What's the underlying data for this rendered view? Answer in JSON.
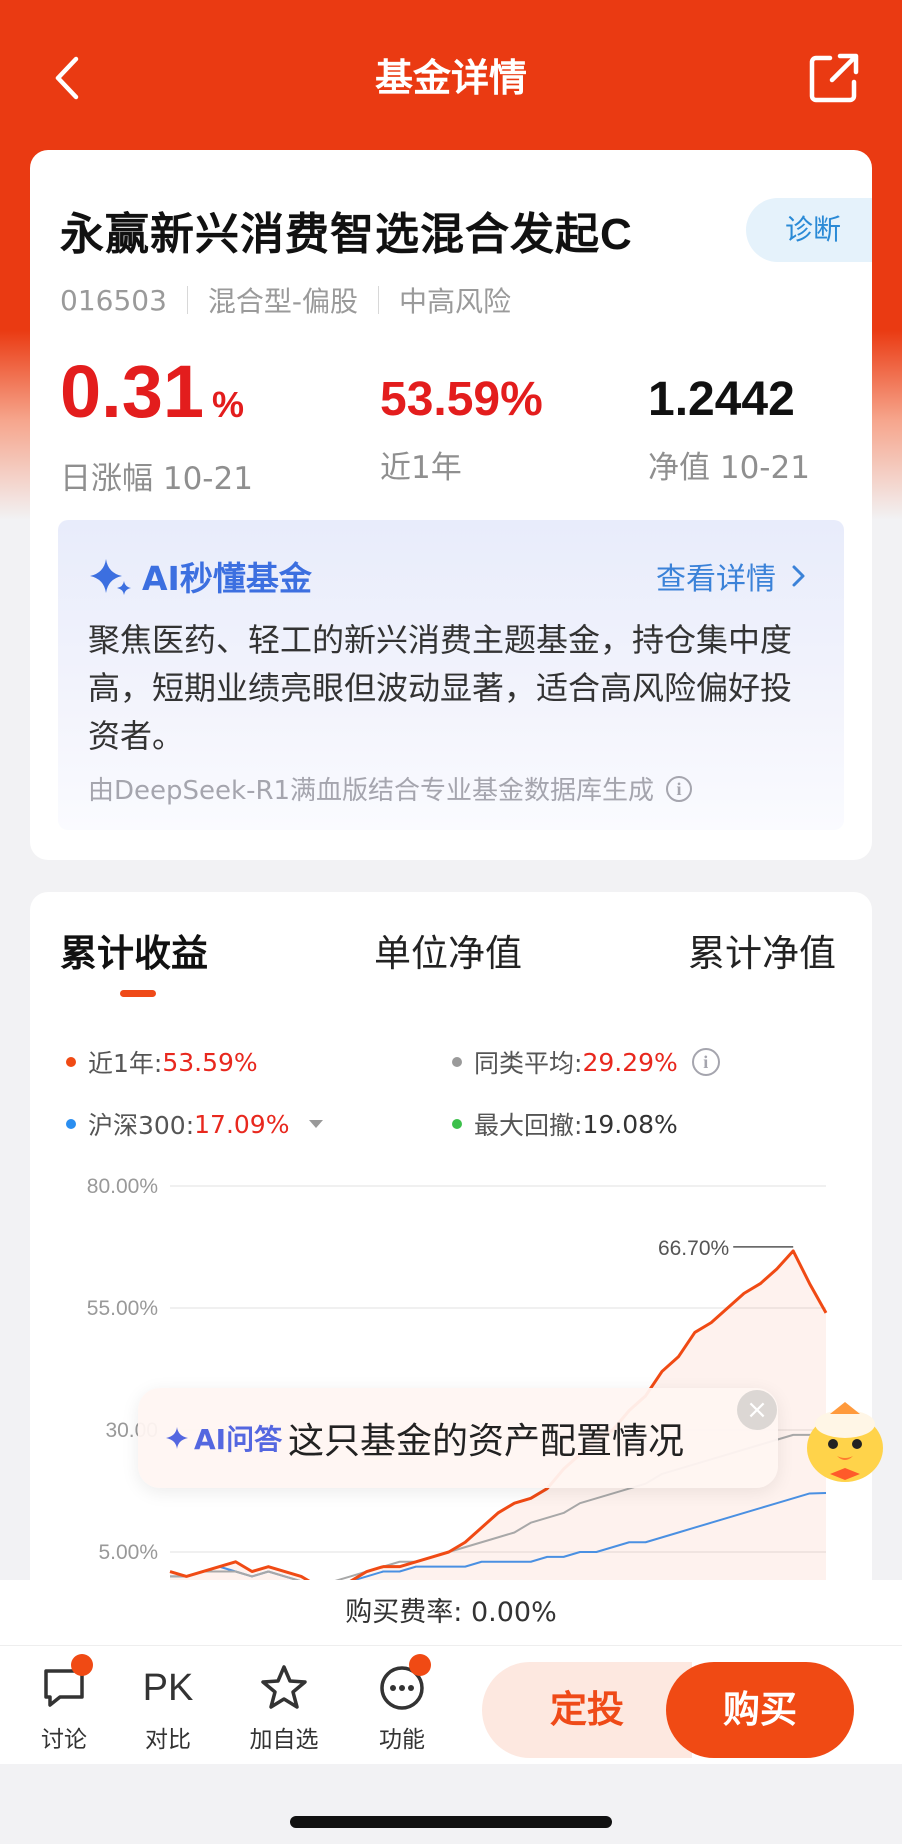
{
  "nav": {
    "title": "基金详情",
    "back_icon": "chevron-left-icon",
    "share_icon": "share-icon"
  },
  "fund": {
    "name": "永赢新兴消费智选混合发起C",
    "code": "016503",
    "type": "混合型-偏股",
    "risk": "中高风险",
    "diagnose_label": "诊断"
  },
  "stats": {
    "daily_change": "0.31",
    "daily_change_unit": "%",
    "daily_change_label": "日涨幅 10-21",
    "year_return": "53.59%",
    "year_return_label": "近1年",
    "nav_value": "1.2442",
    "nav_label": "净值 10-21"
  },
  "ai_summary": {
    "title": "AI秒懂基金",
    "more_label": "查看详情",
    "text": "聚焦医药、轻工的新兴消费主题基金，持仓集中度高，短期业绩亮眼但波动显著，适合高风险偏好投资者。",
    "footer": "由DeepSeek-R1满血版结合专业基金数据库生成"
  },
  "chart_tabs": [
    "累计收益",
    "单位净值",
    "累计净值"
  ],
  "legend": {
    "year": {
      "label": "近1年:",
      "value": "53.59%",
      "color": "#f04a14"
    },
    "peer": {
      "label": "同类平均:",
      "value": "29.29%",
      "color": "#9a9a9a"
    },
    "hs300": {
      "label": "沪深300:",
      "value": "17.09%",
      "color": "#2a8ef0"
    },
    "drawdown": {
      "label": "最大回撤:",
      "value": "19.08%",
      "color": "#3cc04b"
    }
  },
  "chart_data": {
    "type": "line",
    "y_ticks": [
      "80.00%",
      "55.00%",
      "30.00",
      "5.00%"
    ],
    "ylim": [
      -5,
      80
    ],
    "peak_label": "66.70%",
    "x": [
      0,
      1,
      2,
      3,
      4,
      5,
      6,
      7,
      8,
      9,
      10,
      11,
      12,
      13,
      14,
      15,
      16,
      17,
      18,
      19,
      20,
      21,
      22,
      23,
      24,
      25,
      26,
      27,
      28,
      29,
      30,
      31,
      32,
      33,
      34,
      35,
      36,
      37,
      38,
      39,
      40
    ],
    "series": [
      {
        "values": [
          1,
          0,
          1,
          2,
          3,
          1,
          2,
          1,
          0,
          -2,
          -3,
          -1,
          1,
          2,
          2,
          3,
          4,
          5,
          7,
          10,
          13,
          15,
          16,
          18,
          22,
          25,
          28,
          30,
          34,
          37,
          42,
          45,
          50,
          52,
          55,
          58,
          60,
          63,
          66.7,
          60,
          54
        ]
      },
      {
        "values": [
          0,
          0,
          1,
          1,
          1,
          0,
          1,
          0,
          -1,
          -2,
          -1,
          0,
          1,
          2,
          3,
          3,
          4,
          5,
          6,
          7,
          8,
          9,
          11,
          12,
          13,
          15,
          16,
          17,
          18,
          19,
          21,
          22,
          23,
          24,
          25,
          26,
          27,
          28,
          29,
          29,
          29.3
        ]
      },
      {
        "values": [
          0,
          0,
          1,
          2,
          1,
          0,
          1,
          0,
          -1,
          -2,
          -2,
          -1,
          0,
          1,
          1,
          2,
          2,
          2,
          2,
          3,
          3,
          3,
          3,
          4,
          4,
          5,
          5,
          6,
          7,
          7,
          8,
          9,
          10,
          11,
          12,
          13,
          14,
          15,
          16,
          17,
          17.1
        ]
      }
    ]
  },
  "ai_qa": {
    "tag": "AI问答",
    "question": "这只基金的资产配置情况"
  },
  "fee": {
    "label": "购买费率:",
    "value": "0.00%"
  },
  "toolbar": {
    "discuss": "讨论",
    "compare_icon_text": "PK",
    "compare": "对比",
    "favorite": "加自选",
    "functions": "功能",
    "plan_label": "定投",
    "buy_label": "购买"
  }
}
